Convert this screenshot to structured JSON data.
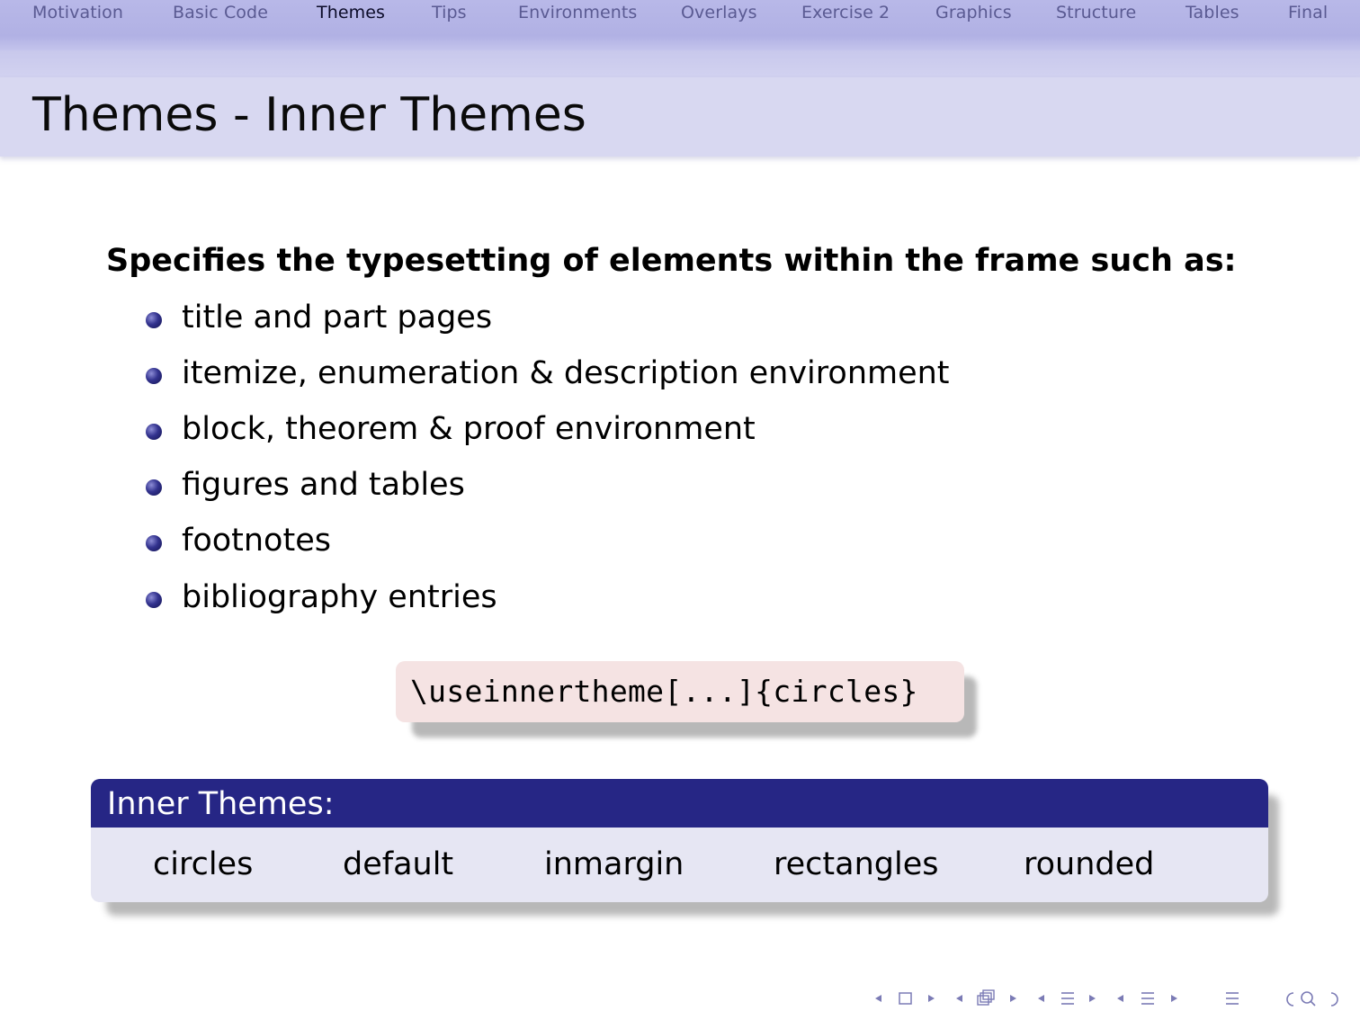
{
  "nav": {
    "sections": [
      {
        "label": "Motivation",
        "active": false
      },
      {
        "label": "Basic Code",
        "active": false
      },
      {
        "label": "Themes",
        "active": true
      },
      {
        "label": "Tips",
        "active": false
      },
      {
        "label": "Environments",
        "active": false
      },
      {
        "label": "Overlays",
        "active": false
      },
      {
        "label": "Exercise 2",
        "active": false
      },
      {
        "label": "Graphics",
        "active": false
      },
      {
        "label": "Structure",
        "active": false
      },
      {
        "label": "Tables",
        "active": false
      },
      {
        "label": "Final",
        "active": false
      }
    ]
  },
  "frame": {
    "title": "Themes - Inner Themes"
  },
  "content": {
    "lead": "Specifies the typesetting of elements within the frame such as:",
    "items": [
      "title and part pages",
      "itemize, enumeration & description environment",
      "block, theorem & proof environment",
      "figures and tables",
      "footnotes",
      "bibliography entries"
    ]
  },
  "code": {
    "text": "\\useinnertheme[...]{circles}"
  },
  "block": {
    "title": "Inner Themes:",
    "cells": [
      "circles",
      "default",
      "inmargin",
      "rectangles",
      "rounded"
    ]
  },
  "beamer_navigation": {
    "icons": [
      "left-arrow-icon",
      "frame-icon",
      "right-arrow-icon",
      "left-arrow-icon",
      "subsection-icon",
      "right-arrow-icon",
      "left-arrow-icon",
      "section-icon",
      "right-arrow-icon",
      "left-arrow-icon",
      "subsection-list-icon",
      "right-arrow-icon",
      "align-icon",
      "back-icon",
      "search-icon",
      "forward-icon"
    ]
  },
  "colors": {
    "nav_bg": "#b1b1e4",
    "title_bg": "#d8d8f1",
    "block_head": "#262685",
    "block_body": "#e6e6f3",
    "code_bg": "#f5e3e3",
    "nav_text": "#5a5a92",
    "bullet": "#33338f"
  }
}
